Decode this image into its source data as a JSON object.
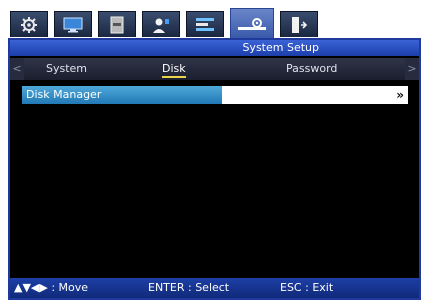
{
  "icon_bar": {
    "tabs": [
      {
        "icon": "gear-icon"
      },
      {
        "icon": "monitor-icon"
      },
      {
        "icon": "hdd-icon"
      },
      {
        "icon": "user-icon"
      },
      {
        "icon": "network-icon"
      },
      {
        "icon": "system-setup-icon",
        "active": true
      },
      {
        "icon": "exit-icon"
      }
    ]
  },
  "window": {
    "title": "System Setup",
    "tabs": [
      {
        "label": "System"
      },
      {
        "label": "Disk",
        "active": true
      },
      {
        "label": "Password"
      }
    ],
    "left_arrow": "<",
    "right_arrow": ">"
  },
  "menu": {
    "items": [
      {
        "label": "Disk Manager",
        "arrow": "»"
      }
    ]
  },
  "status": {
    "move": ": Move",
    "move_keys": "▲▼◀▶",
    "select": "ENTER : Select",
    "exit": "ESC : Exit"
  },
  "colors": {
    "accent": "#1f3a9c",
    "highlight": "#2178b6",
    "tab_underline": "#e8d44a"
  }
}
